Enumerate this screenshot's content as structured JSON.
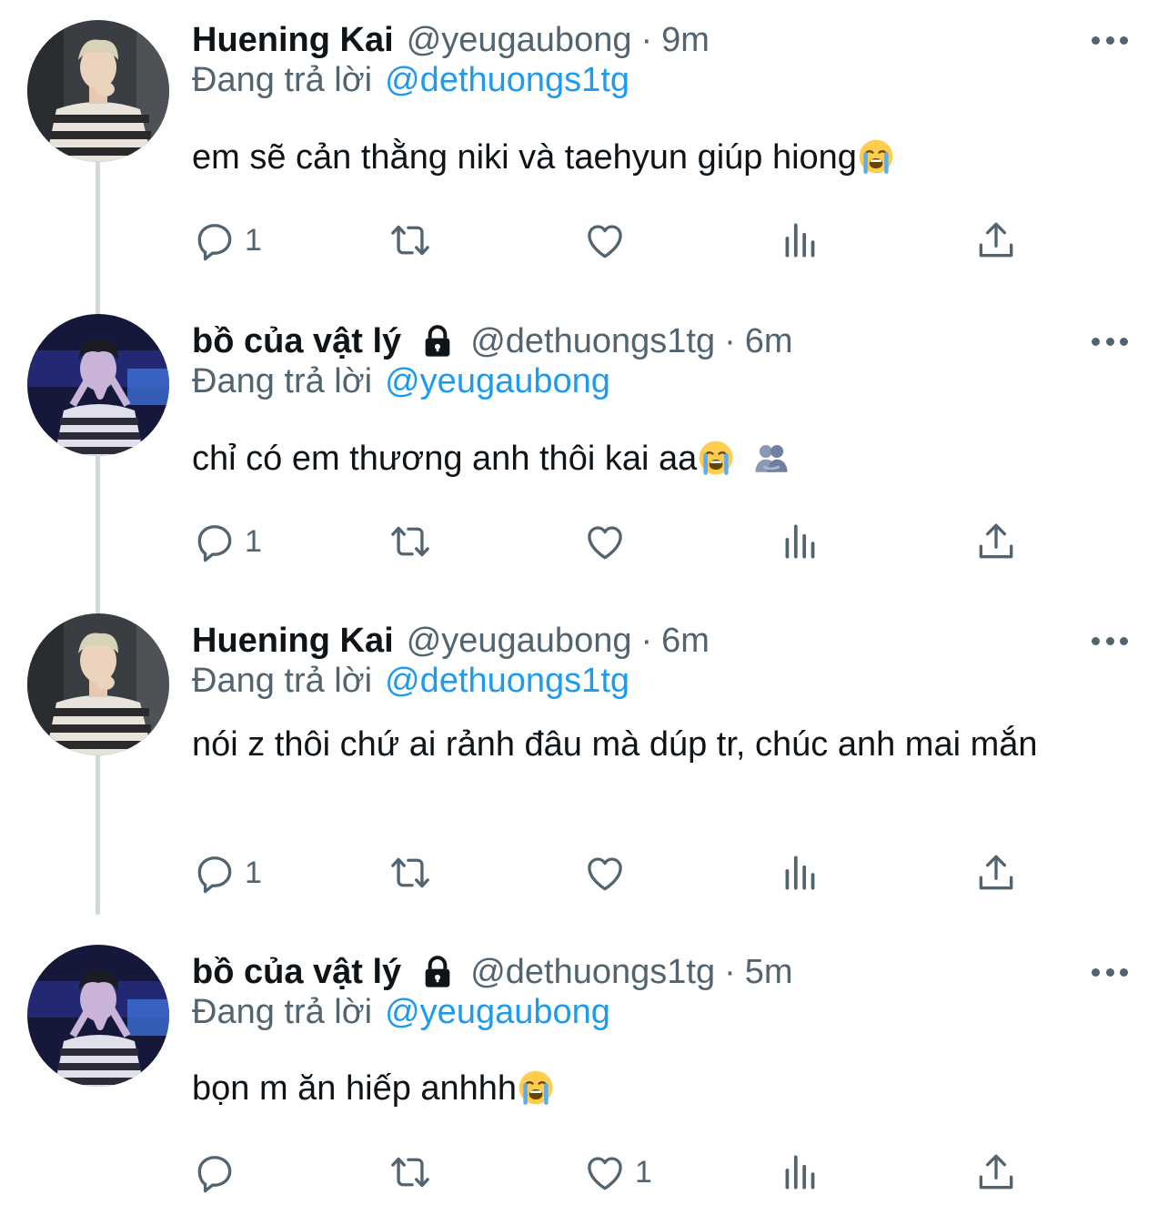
{
  "colors": {
    "text": "#0f1419",
    "secondary": "#536471",
    "accent": "#1d9bf0",
    "thread_line": "#cfd9de"
  },
  "reply_prefix": "Đang trả lời",
  "tweets": [
    {
      "name": "Huening Kai",
      "handle": "@yeugaubong",
      "separator": "·",
      "time": "9m",
      "locked": false,
      "replying_to": "@dethuongs1tg",
      "text": "em sẽ cản thằng niki và taehyun giúp hiong",
      "emojis": [
        "loudly-crying-face"
      ],
      "actions": {
        "reply_count": "1",
        "retweet_count": "",
        "like_count": ""
      }
    },
    {
      "name": "bồ của vật lý",
      "handle": "@dethuongs1tg",
      "separator": "·",
      "time": "6m",
      "locked": true,
      "replying_to": "@yeugaubong",
      "text": "chỉ có em thương anh thôi kai aa",
      "emojis": [
        "loudly-crying-face",
        "people-hugging"
      ],
      "actions": {
        "reply_count": "1",
        "retweet_count": "",
        "like_count": ""
      }
    },
    {
      "name": "Huening Kai",
      "handle": "@yeugaubong",
      "separator": "·",
      "time": "6m",
      "locked": false,
      "replying_to": "@dethuongs1tg",
      "text": "nói z thôi chứ ai rảnh đâu mà dúp tr, chúc anh mai mắn",
      "emojis": [],
      "actions": {
        "reply_count": "1",
        "retweet_count": "",
        "like_count": ""
      }
    },
    {
      "name": "bồ của vật lý",
      "handle": "@dethuongs1tg",
      "separator": "·",
      "time": "5m",
      "locked": true,
      "replying_to": "@yeugaubong",
      "text": "bọn m ăn hiếp anhhh",
      "emojis": [
        "loudly-crying-face"
      ],
      "actions": {
        "reply_count": "",
        "retweet_count": "",
        "like_count": "1"
      }
    }
  ]
}
